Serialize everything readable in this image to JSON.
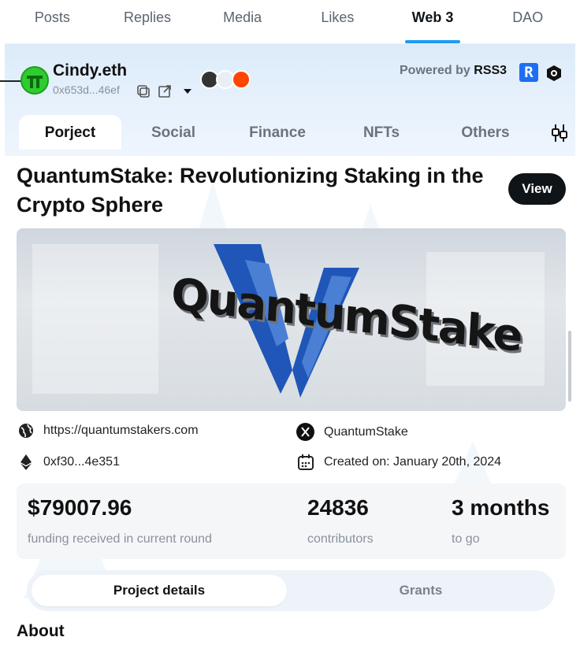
{
  "top_tabs": [
    "Posts",
    "Replies",
    "Media",
    "Likes",
    "Web 3",
    "DAO"
  ],
  "active_top_tab": "Web 3",
  "profile": {
    "name": "Cindy.eth",
    "address": "0x653d...46ef"
  },
  "powered_by": {
    "prefix": "Powered by",
    "brand": "RSS3",
    "logo_letter": "R"
  },
  "sub_tabs": [
    "Porject",
    "Social",
    "Finance",
    "NFTs",
    "Others"
  ],
  "active_sub_tab": "Porject",
  "project": {
    "title": "QuantumStake: Revolutionizing Staking in the Crypto Sphere",
    "view_label": "View",
    "banner_text": "QuantumStake",
    "website": "https://quantumstakers.com",
    "twitter": "QuantumStake",
    "contract": "0xf30...4e351",
    "created": "Created on: January 20th, 2024"
  },
  "stats": [
    {
      "value": "$79007.96",
      "label": "funding received in current round"
    },
    {
      "value": "24836",
      "label": "contributors"
    },
    {
      "value": "3 months",
      "label": "to go"
    }
  ],
  "segment": {
    "active": "Project details",
    "inactive": "Grants"
  },
  "about_heading": "About",
  "colors": {
    "accent": "#1d9bf0",
    "brand_blue": "#1d6ff2",
    "avatar_green": "#2ecc2e",
    "dark_button": "#0f1419"
  },
  "icons": [
    "copy-icon",
    "external-link-icon",
    "caret-down-icon",
    "globe-icon",
    "x-logo-icon",
    "ethereum-icon",
    "calendar-icon",
    "filter-icon",
    "hexagon-icon"
  ]
}
